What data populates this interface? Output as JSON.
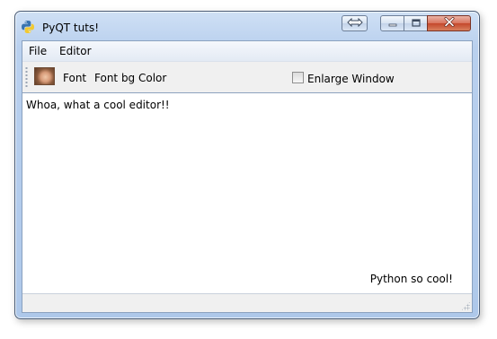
{
  "window": {
    "title": "PyQT tuts!",
    "app_icon": "python-logo-icon",
    "controls": {
      "resize_icon": "double-arrow-icon",
      "minimize_icon": "minimize-icon",
      "maximize_icon": "maximize-icon",
      "close_icon": "close-icon"
    }
  },
  "menubar": {
    "items": [
      {
        "label": "File"
      },
      {
        "label": "Editor"
      }
    ]
  },
  "toolbar": {
    "image_icon": "face-photo-icon",
    "font_label": "Font",
    "font_bg_label": "Font bg Color",
    "checkbox": {
      "label": "Enlarge Window",
      "checked": false
    }
  },
  "editor": {
    "text": "Whoa, what a cool editor!!"
  },
  "corner_label": "Python so cool!",
  "colors": {
    "frame": "#b9d0ee",
    "close_button": "#c4472b",
    "client_bg": "#f0f0f0",
    "editor_bg": "#ffffff"
  }
}
